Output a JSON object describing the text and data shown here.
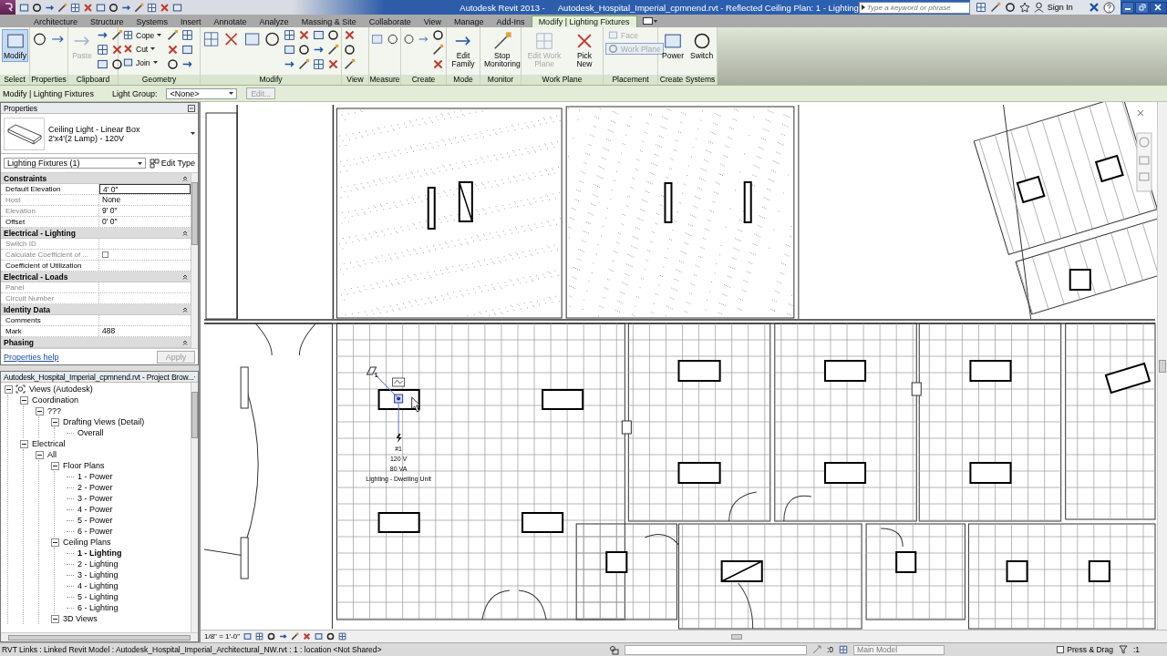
{
  "title_bar": {
    "app_name": "Autodesk Revit 2013 -",
    "document": "Autodesk_Hospital_Imperial_cpmnend.rvt - Reflected Ceiling Plan: 1 - Lighting",
    "search": {
      "placeholder": "Type a keyword or phrase"
    },
    "sign_in": "Sign In"
  },
  "tabs": [
    {
      "label": "Architecture",
      "selected": false
    },
    {
      "label": "Structure",
      "selected": false
    },
    {
      "label": "Systems",
      "selected": false
    },
    {
      "label": "Insert",
      "selected": false
    },
    {
      "label": "Annotate",
      "selected": false
    },
    {
      "label": "Analyze",
      "selected": false
    },
    {
      "label": "Massing & Site",
      "selected": false
    },
    {
      "label": "Collaborate",
      "selected": false
    },
    {
      "label": "View",
      "selected": false
    },
    {
      "label": "Manage",
      "selected": false
    },
    {
      "label": "Add-Ins",
      "selected": false
    },
    {
      "label": "Modify | Lighting Fixtures",
      "selected": true
    }
  ],
  "ribbon": {
    "panels": [
      {
        "label": "Select",
        "tools": [
          {
            "kind": "large",
            "label": "Modify",
            "selected": true,
            "disabled": false
          }
        ]
      },
      {
        "label": "Properties"
      },
      {
        "label": "Clipboard",
        "tools": [
          {
            "kind": "large",
            "label": "Paste",
            "selected": false,
            "disabled": true
          }
        ]
      },
      {
        "label": "Geometry",
        "tools": [
          {
            "kind": "dropdown",
            "label": "Cope",
            "selected": false,
            "disabled": false
          },
          {
            "kind": "dropdown",
            "label": "Cut",
            "selected": false,
            "disabled": false
          },
          {
            "kind": "dropdown",
            "label": "Join",
            "selected": false,
            "disabled": false
          }
        ]
      },
      {
        "label": "Modify"
      },
      {
        "label": "View"
      },
      {
        "label": "Measure"
      },
      {
        "label": "Create"
      },
      {
        "label": "Mode",
        "tools": [
          {
            "kind": "large",
            "label": "Edit Family",
            "selected": false,
            "disabled": false
          }
        ]
      },
      {
        "label": "Monitor",
        "tools": [
          {
            "kind": "large",
            "label": "Stop Monitoring",
            "selected": false,
            "disabled": false
          }
        ]
      },
      {
        "label": "Work Plane",
        "tools": [
          {
            "kind": "large",
            "label": "Edit Work Plane",
            "selected": false,
            "disabled": true
          },
          {
            "kind": "large",
            "label": "Pick New",
            "selected": false,
            "disabled": false
          }
        ]
      },
      {
        "label": "Placement",
        "tools": [
          {
            "kind": "small",
            "label": "Face",
            "selected": false,
            "disabled": true
          },
          {
            "kind": "small",
            "label": "Work Plane",
            "selected": true,
            "disabled": true
          }
        ]
      },
      {
        "label": "Create Systems",
        "tools": [
          {
            "kind": "large",
            "label": "Power",
            "selected": false,
            "disabled": false
          },
          {
            "kind": "large",
            "label": "Switch",
            "selected": false,
            "disabled": false
          }
        ]
      }
    ]
  },
  "options_bar": {
    "context": "Modify | Lighting Fixtures",
    "light_group_label": "Light Group:",
    "light_group_value": "<None>",
    "edit_button": {
      "label": "Edit...",
      "disabled": true
    }
  },
  "properties": {
    "title": "Properties",
    "type_family": "Ceiling Light - Linear Box",
    "type_name": "2'x4'(2 Lamp) - 120V",
    "instance_filter": "Lighting Fixtures (1)",
    "edit_type": "Edit Type",
    "groups": [
      {
        "name": "Constraints",
        "expanded": true,
        "rows": [
          {
            "label": "Default Elevation",
            "value": "4' 0\"",
            "kind": "text",
            "readonly": false,
            "selected": true
          },
          {
            "label": "Host",
            "value": "None",
            "kind": "text",
            "readonly": true,
            "selected": false
          },
          {
            "label": "Elevation",
            "value": "9' 0\"",
            "kind": "text",
            "readonly": true,
            "selected": false
          },
          {
            "label": "Offset",
            "value": "0' 0\"",
            "kind": "text",
            "readonly": false,
            "selected": false
          }
        ]
      },
      {
        "name": "Electrical - Lighting",
        "expanded": true,
        "rows": [
          {
            "label": "Switch ID",
            "kind": "text",
            "readonly": true,
            "selected": false
          },
          {
            "label": "Calculate Coefficient of ...",
            "kind": "checkbox",
            "checked": false,
            "readonly": true,
            "selected": false
          },
          {
            "label": "Coefficient of Utilization",
            "kind": "text",
            "readonly": false,
            "selected": false
          }
        ]
      },
      {
        "name": "Electrical - Loads",
        "expanded": true,
        "rows": [
          {
            "label": "Panel",
            "kind": "text",
            "readonly": true,
            "selected": false
          },
          {
            "label": "Circuit Number",
            "kind": "text",
            "readonly": true,
            "selected": false
          }
        ]
      },
      {
        "name": "Identity Data",
        "expanded": true,
        "rows": [
          {
            "label": "Comments",
            "kind": "text",
            "readonly": false,
            "selected": false
          },
          {
            "label": "Mark",
            "value": "488",
            "kind": "text",
            "readonly": false,
            "selected": false
          }
        ]
      },
      {
        "name": "Phasing",
        "expanded": true
      }
    ],
    "help_link": "Properties help",
    "apply_button": {
      "label": "Apply",
      "disabled": true
    }
  },
  "project_browser": {
    "title": "Autodesk_Hospital_Imperial_cpmnend.rvt - Project Brow...",
    "tree": [
      {
        "label": "Views (Autodesk)",
        "selected": false,
        "expanded": true,
        "children": [
          {
            "label": "Coordination",
            "selected": false,
            "expanded": true,
            "children": [
              {
                "label": "???",
                "selected": false,
                "expanded": true,
                "children": [
                  {
                    "label": "Drafting Views (Detail)",
                    "selected": false,
                    "expanded": true,
                    "children": [
                      {
                        "label": "Overall",
                        "selected": false
                      }
                    ]
                  }
                ]
              }
            ]
          },
          {
            "label": "Electrical",
            "selected": false,
            "expanded": true,
            "children": [
              {
                "label": "All",
                "selected": false,
                "expanded": true,
                "children": [
                  {
                    "label": "Floor Plans",
                    "selected": false,
                    "expanded": true,
                    "children": [
                      {
                        "label": "1 - Power",
                        "selected": false
                      },
                      {
                        "label": "2 - Power",
                        "selected": false
                      },
                      {
                        "label": "3 - Power",
                        "selected": false
                      },
                      {
                        "label": "4 - Power",
                        "selected": false
                      },
                      {
                        "label": "5 - Power",
                        "selected": false
                      },
                      {
                        "label": "6 - Power",
                        "selected": false
                      }
                    ]
                  },
                  {
                    "label": "Ceiling Plans",
                    "selected": false,
                    "expanded": true,
                    "children": [
                      {
                        "label": "1 - Lighting",
                        "selected": true
                      },
                      {
                        "label": "2 - Lighting",
                        "selected": false
                      },
                      {
                        "label": "3 - Lighting",
                        "selected": false
                      },
                      {
                        "label": "4 - Lighting",
                        "selected": false
                      },
                      {
                        "label": "5 - Lighting",
                        "selected": false
                      },
                      {
                        "label": "6 - Lighting",
                        "selected": false
                      }
                    ]
                  },
                  {
                    "label": "3D Views",
                    "selected": false,
                    "expanded": true
                  }
                ]
              }
            ]
          }
        ]
      }
    ]
  },
  "view": {
    "scale": "1/8\" = 1'-0\"",
    "tag": {
      "tag_number": "1",
      "circuit": "#1",
      "voltage": "120 V",
      "load": "80 VA",
      "load_name": "Lighting - Dwelling Unit"
    }
  },
  "status_bar": {
    "message": "RVT Links : Linked Revit Model : Autodesk_Hospital_Imperial_Architectural_NW.rvt : 1 : location <Not Shared>",
    "editable_count": ":0",
    "model": "Main Model",
    "press_drag": {
      "label": "Press & Drag",
      "checked": false
    },
    "filter_count": ":1"
  }
}
